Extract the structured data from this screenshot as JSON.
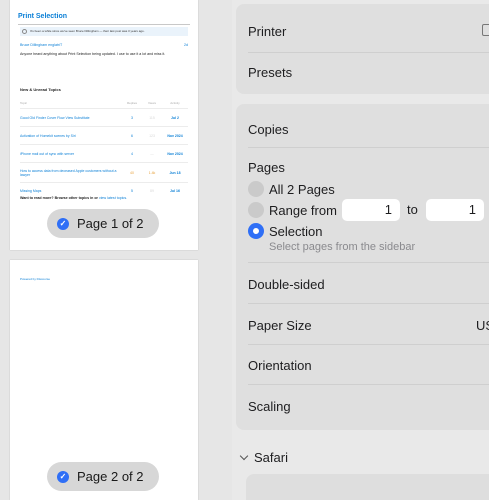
{
  "preview": {
    "page1": {
      "doc_title": "Print Selection",
      "notice": "It's been a while since we've seen Bruce Dillingham — their last post was 3 years ago.",
      "post_author": "Bruce Dillingham  englatriT",
      "post_number": "2d",
      "post_body": "Anyone heard anything about Print Selection being updated. I use to use it a lot and miss it.",
      "section_title": "New & Unread Topics",
      "table_headers": [
        "Topic",
        "Replies",
        "Views",
        "Activity"
      ],
      "topics": [
        {
          "title": "Good Old Finder Cover Flow View Substitute",
          "replies": "3",
          "views": "115",
          "activity": "Jul 2",
          "hot": false
        },
        {
          "title": "Activation of Homekit scenes by Siri",
          "replies": "6",
          "views": "123",
          "activity": "Nov 2024",
          "hot": false
        },
        {
          "title": "iPhone mail out of sync with server",
          "replies": "4",
          "views": "—",
          "activity": "Nov 2024",
          "hot": false
        },
        {
          "title": "How to access data from deceased Apple customers without a lawyer",
          "replies": "40",
          "views": "1.4k",
          "activity": "Jun 18",
          "hot": true
        },
        {
          "title": "Missing Maps",
          "replies": "5",
          "views": "89",
          "activity": "Jul 16",
          "hot": false
        }
      ],
      "read_more": "Want to read more? Browse other topics in  or ",
      "read_more_link": "view latest topics.",
      "label": "Page 1 of 2",
      "selected": true
    },
    "page2": {
      "footer": "Powered by Discourse",
      "label": "Page 2 of 2",
      "selected": true
    }
  },
  "settings": {
    "printer_label": "Printer",
    "presets_label": "Presets",
    "copies_label": "Copies",
    "pages_label": "Pages",
    "options": [
      {
        "label": "All 2 Pages",
        "selected": false
      },
      {
        "label": "Range from",
        "selected": false
      },
      {
        "label": "Selection",
        "selected": true
      }
    ],
    "range_from": "1",
    "range_to_label": "to",
    "range_to": "1",
    "selection_hint": "Select pages from the sidebar",
    "double_sided_label": "Double-sided",
    "paper_size_label": "Paper Size",
    "paper_size_value": "US",
    "orientation_label": "Orientation",
    "scaling_label": "Scaling",
    "safari_label": "Safari"
  },
  "colors": {
    "accent": "#2f6ff6",
    "link": "#0a7fd6"
  }
}
